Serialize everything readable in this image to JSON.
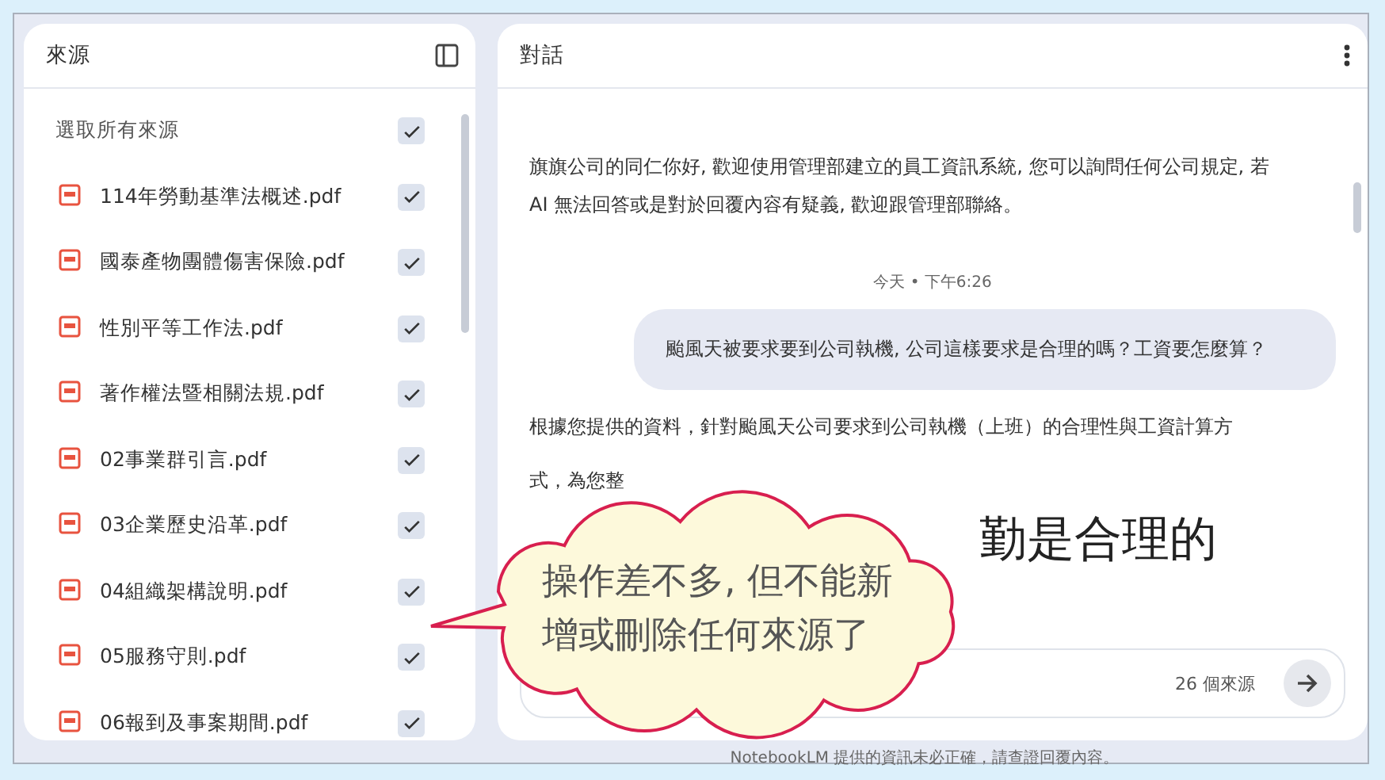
{
  "sources_panel": {
    "title": "來源",
    "select_all": {
      "label": "選取所有來源",
      "checked": true
    },
    "sources": [
      {
        "name": "114年勞動基準法概述.pdf",
        "checked": true
      },
      {
        "name": "國泰產物團體傷害保險.pdf",
        "checked": true
      },
      {
        "name": "性別平等工作法.pdf",
        "checked": true
      },
      {
        "name": "著作權法暨相關法規.pdf",
        "checked": true
      },
      {
        "name": "02事業群引言.pdf",
        "checked": true
      },
      {
        "name": "03企業歷史沿革.pdf",
        "checked": true
      },
      {
        "name": "04組織架構說明.pdf",
        "checked": true
      },
      {
        "name": "05服務守則.pdf",
        "checked": true
      },
      {
        "name": "06報到及事案期間.pdf",
        "checked": true
      }
    ]
  },
  "chat_panel": {
    "title": "對話",
    "intro": "旗旗公司的同仁你好, 歡迎使用管理部建立的員工資訊系統, 您可以詢問任何公司規定, 若 AI 無法回答或是對於回覆內容有疑義, 歡迎跟管理部聯絡。",
    "timestamp": "今天 • 下午6:26",
    "user_message": "颱風天被要求要到公司執機, 公司這樣要求是合理的嗎？工資要怎麼算？",
    "response_lines": [
      "根據您提供的資料，針對颱風天公司要求到公司執機（上班）的合理性與工資計算方",
      "式，為您整"
    ],
    "response_heading": "勤是合理的",
    "source_count": "26 個來源"
  },
  "footer": "NotebookLM 提供的資訊未必正確，請查證回覆內容。",
  "callout": {
    "lines": [
      "操作差不多, 但不能新",
      "增或刪除任何來源了"
    ]
  }
}
